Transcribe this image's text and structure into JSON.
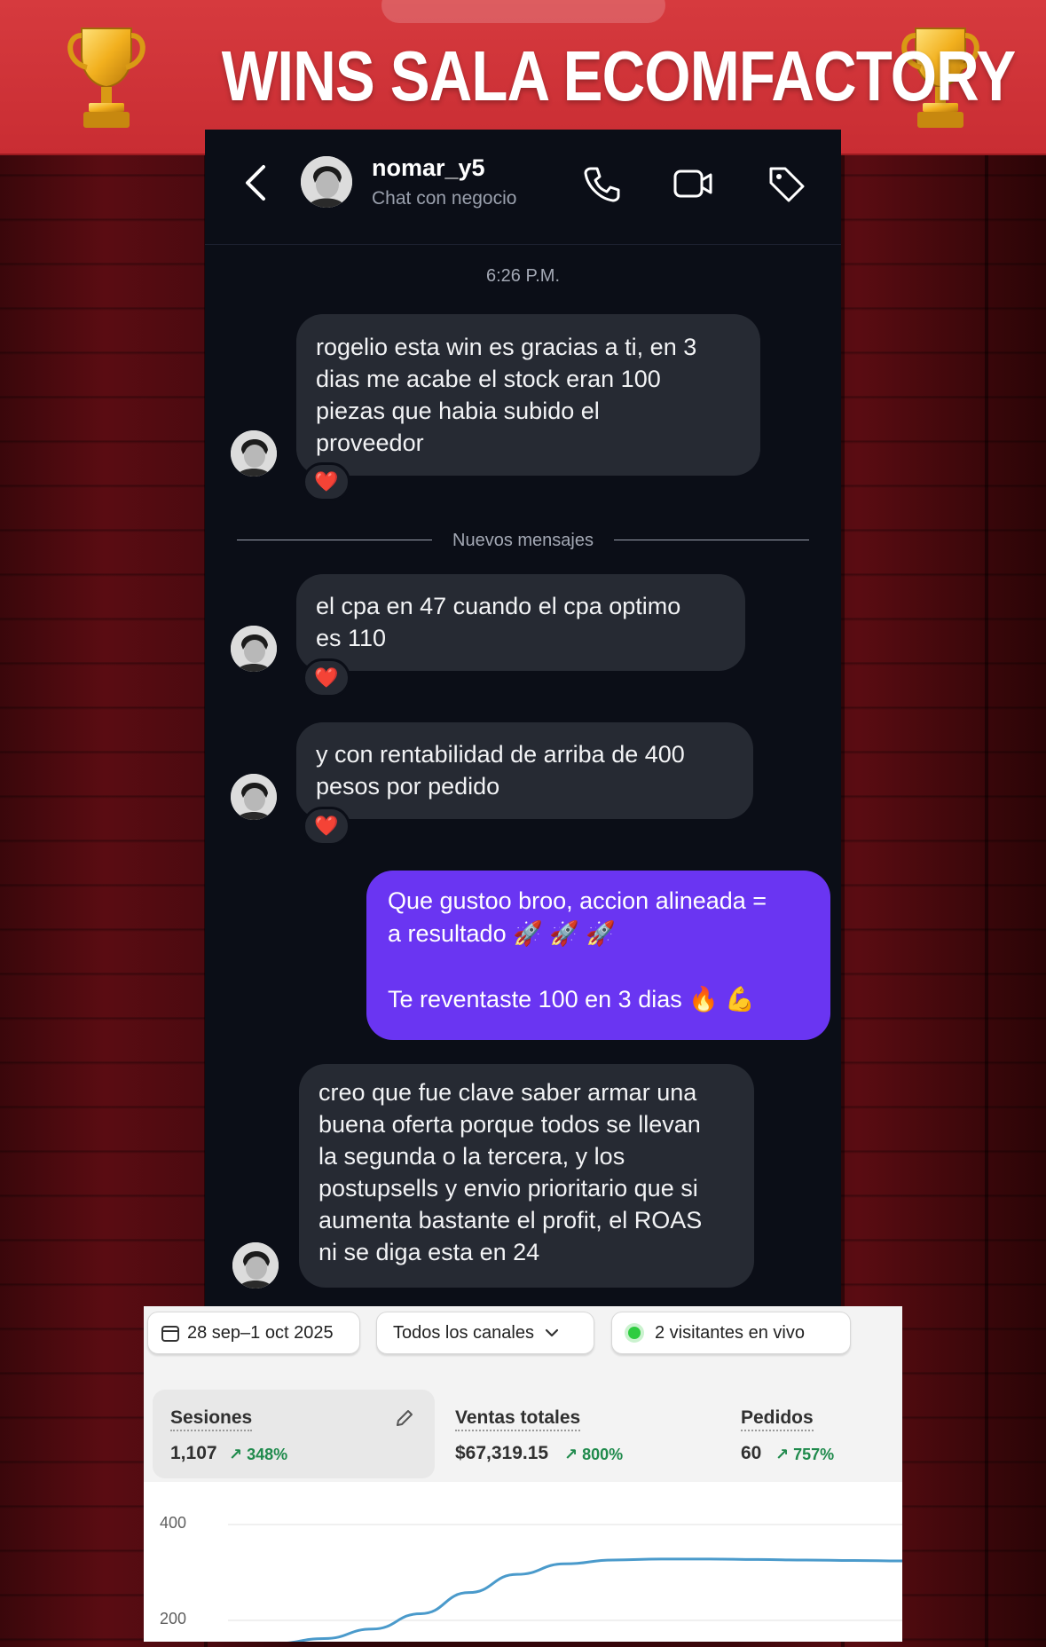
{
  "banner": {
    "title": "WINS SALA ECOMFACTORY",
    "trophy_icon": "trophy-icon"
  },
  "chat": {
    "header": {
      "username": "nomar_y5",
      "subtitle": "Chat con negocio",
      "icons": [
        "back-icon",
        "phone-icon",
        "video-icon",
        "tag-icon"
      ]
    },
    "timestamp": "6:26 P.M.",
    "divider_label": "Nuevos mensajes",
    "messages": [
      {
        "from": "other",
        "text": "rogelio esta win es gracias a ti, en 3\ndias me acabe el stock eran 100\npiezas que habia subido el\nproveedor",
        "reaction": "❤️"
      },
      {
        "from": "other",
        "text": "el cpa en 47 cuando el cpa optimo\nes 110",
        "reaction": "❤️"
      },
      {
        "from": "other",
        "text": "y con rentabilidad de arriba de 400\npesos por pedido",
        "reaction": "❤️"
      },
      {
        "from": "me",
        "text": "Que gustoo broo, accion alineada =\na resultado 🚀 🚀 🚀\n\nTe reventaste 100 en 3 dias 🔥 💪"
      },
      {
        "from": "other",
        "text": "creo que fue clave saber armar una\nbuena oferta porque todos se llevan\nla segunda o la tercera, y los\npostupsells y envio prioritario que si\naumenta bastante el profit, el ROAS\nni se diga esta en 24"
      }
    ],
    "colors": {
      "bubble_in": "#262a33",
      "bubble_out": "#6a35f2",
      "background": "#0b0e17"
    }
  },
  "analytics": {
    "date_range": "28 sep–1 oct 2025",
    "channels": "Todos los canales",
    "live_visitors": "2 visitantes en vivo",
    "metrics": [
      {
        "label": "Sesiones",
        "value": "1,107",
        "change": "348%"
      },
      {
        "label": "Ventas totales",
        "value": "$67,319.15",
        "change": "800%"
      },
      {
        "label": "Pedidos",
        "value": "60",
        "change": "757%"
      }
    ],
    "chart_data": {
      "type": "line",
      "ylim": [
        130,
        430
      ],
      "y_ticks": [
        "400",
        "200"
      ],
      "series": [
        {
          "values": [
            148,
            152,
            162,
            182,
            214,
            258,
            296,
            318,
            326,
            328,
            328,
            327,
            326,
            325,
            324
          ]
        }
      ],
      "color": "#4a9acb"
    },
    "colors": {
      "positive": "#1f8a4c",
      "live_dot": "#2ecc40"
    }
  }
}
